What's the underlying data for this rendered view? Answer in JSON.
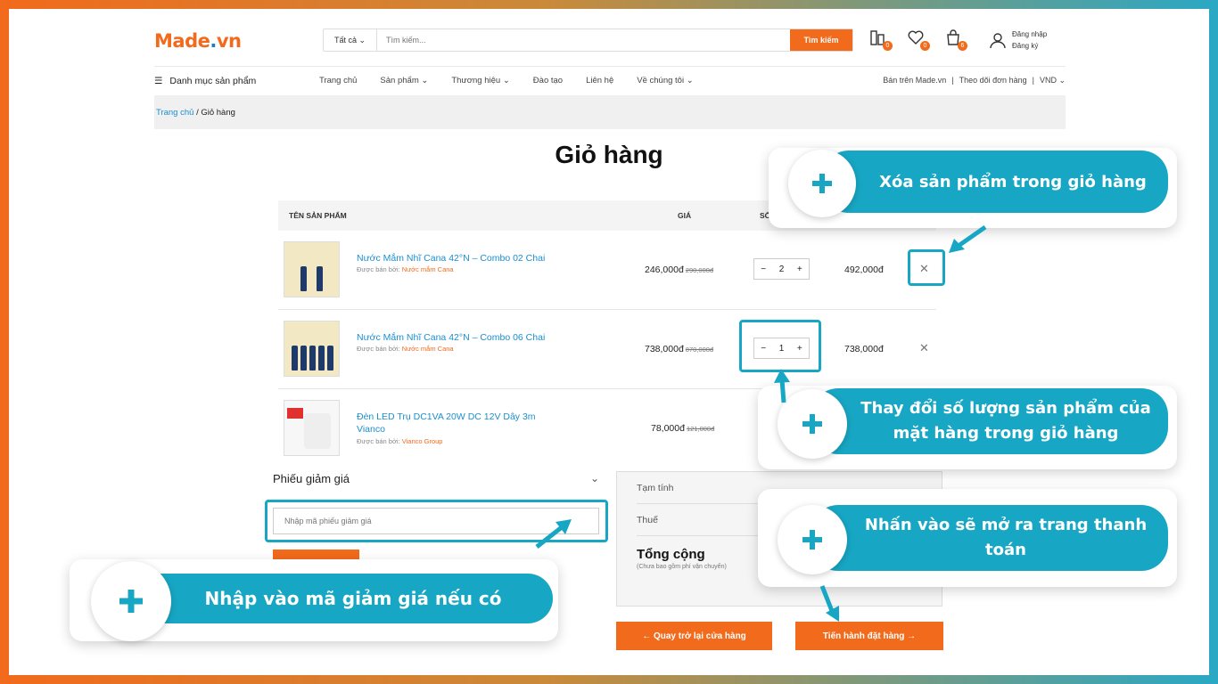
{
  "header": {
    "logo_main": "Made",
    "logo_dot": ".",
    "logo_tld": "vn",
    "category": "Tất cả",
    "search_placeholder": "Tìm kiếm...",
    "search_button": "Tìm kiếm",
    "compare_count": "0",
    "wishlist_count": "0",
    "cart_count": "6",
    "login": "Đăng nhập",
    "register": "Đăng ký"
  },
  "nav": {
    "menu_label": "Danh mục sản phẩm",
    "links": [
      "Trang chủ",
      "Sản phẩm",
      "Thương hiệu",
      "Đào tạo",
      "Liên hệ",
      "Về chúng tôi"
    ],
    "sell": "Bán trên Made.vn",
    "track": "Theo dõi đơn hàng",
    "currency": "VND",
    "sep": "|"
  },
  "breadcrumb": {
    "home": "Trang chủ",
    "sep": "/",
    "current": "Giỏ hàng"
  },
  "page_title": "Giỏ hàng",
  "table": {
    "col_name": "TÊN SẢN PHẨM",
    "col_price": "GIÁ",
    "col_qty": "SỐ LƯỢNG",
    "rows": [
      {
        "name": "Nước Mắm Nhĩ Cana 42°N – Combo 02 Chai",
        "seller_prefix": "Được bán bởi:",
        "seller": "Nước mắm Cana",
        "price": "246,000đ",
        "old_price": "290,000đ",
        "qty": "2",
        "subtotal": "492,000đ"
      },
      {
        "name": "Nước Mắm Nhĩ Cana 42°N – Combo 06 Chai",
        "seller_prefix": "Được bán bởi:",
        "seller": "Nước mắm Cana",
        "price": "738,000đ",
        "old_price": "870,000đ",
        "qty": "1",
        "subtotal": "738,000đ"
      },
      {
        "name": "Đèn LED Trụ DC1VA 20W DC 12V Dây 3m Vianco",
        "seller_prefix": "Được bán bởi:",
        "seller": "Vianco Group",
        "price": "78,000đ",
        "old_price": "121,000đ"
      }
    ]
  },
  "coupon": {
    "title": "Phiếu giảm giá",
    "placeholder": "Nhập mã phiếu giảm giá"
  },
  "summary": {
    "subtotal_label": "Tạm tính",
    "tax_label": "Thuế",
    "total_label": "Tổng cộng",
    "total_note": "(Chưa bao gồm phí vận chuyển)"
  },
  "buttons": {
    "back": "← Quay trở lại cửa hàng",
    "checkout": "Tiến hành đặt hàng →"
  },
  "callouts": {
    "delete": "Xóa sản phẩm trong giỏ hàng",
    "quantity": "Thay đổi số lượng sản phẩm của mặt hàng trong giỏ hàng",
    "checkout": "Nhấn vào sẽ mở ra trang thanh toán",
    "coupon": "Nhập vào mã giảm giá nếu có"
  },
  "colors": {
    "brand_orange": "#f26a1b",
    "accent_teal": "#17a7c4",
    "link_blue": "#1a8fd0"
  }
}
